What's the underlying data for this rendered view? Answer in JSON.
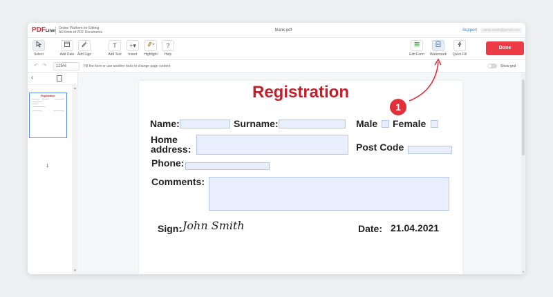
{
  "header": {
    "logo_main": "PDF",
    "logo_sub": "Liner",
    "tagline_line1": "Online Platform for Editing",
    "tagline_line2": "All Kinds of PDF Documents",
    "doc_title": "blank.pdf",
    "support_label": "Support",
    "email": "carrie.smith@gmail.com"
  },
  "toolbar": {
    "select": "Select",
    "add_date": "Add Date",
    "add_sign": "Add Sign",
    "add_text": "Add Text",
    "insert": "Insert",
    "highlight": "Highlight",
    "help": "Help",
    "edit_form": "Edit Form",
    "watermark": "Watermark",
    "quick_fill": "Quick Fill",
    "done": "Done",
    "icons": {
      "select": "cursor-icon",
      "add_date": "calendar-icon",
      "add_sign": "pen-icon",
      "add_text": "text-icon",
      "insert": "plus-icon",
      "highlight": "marker-icon",
      "help": "question-icon",
      "edit_form": "form-icon",
      "watermark": "watermark-icon",
      "quick_fill": "lightning-icon"
    },
    "done_color": "#ec3b45"
  },
  "subbar": {
    "zoom": "125%",
    "hint": "Fill the form or use another tools to change page content",
    "show_grid": "Show grid"
  },
  "sidebar": {
    "thumb_title": "Registration",
    "page_number": "1"
  },
  "document": {
    "title": "Registration",
    "title_color": "#c0202a",
    "name_label": "Name:",
    "surname_label": "Surname:",
    "male_label": "Male",
    "female_label": "Female",
    "home_label_1": "Home",
    "home_label_2": "address:",
    "postcode_label": "Post Code",
    "phone_label": "Phone:",
    "comments_label": "Comments:",
    "sign_label": "Sign:",
    "signature": "John Smith",
    "date_label": "Date:",
    "date_value": "21.04.2021"
  },
  "callout": {
    "number": "1",
    "color": "#e0303a"
  }
}
